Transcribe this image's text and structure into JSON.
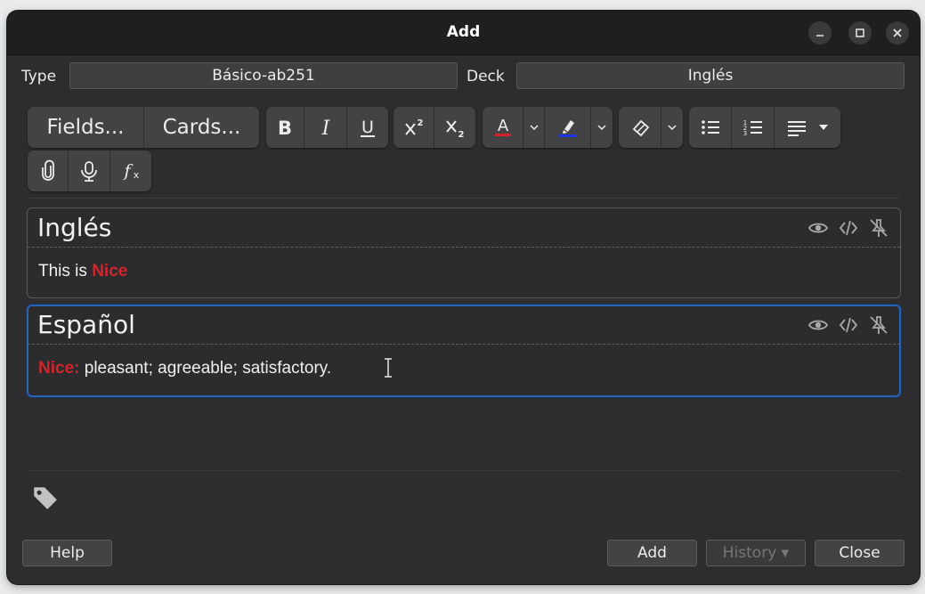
{
  "window": {
    "title": "Add"
  },
  "type": {
    "label": "Type",
    "value": "Básico-ab251"
  },
  "deck": {
    "label": "Deck",
    "value": "Inglés"
  },
  "toolbar": {
    "fields_label": "Fields...",
    "cards_label": "Cards..."
  },
  "fields": [
    {
      "name": "Inglés",
      "content_prefix": "This is ",
      "content_highlight": "Nice",
      "content_suffix": ""
    },
    {
      "name": "Español",
      "content_prefix": "",
      "content_highlight": "Nice:",
      "content_suffix": " pleasant; agreeable; satisfactory."
    }
  ],
  "buttons": {
    "help": "Help",
    "add": "Add",
    "history": "History ▾",
    "close": "Close"
  },
  "colors": {
    "text_color": "#d2242b",
    "highlight_color": "#1c33e6",
    "focus_border": "#2a62b4"
  }
}
